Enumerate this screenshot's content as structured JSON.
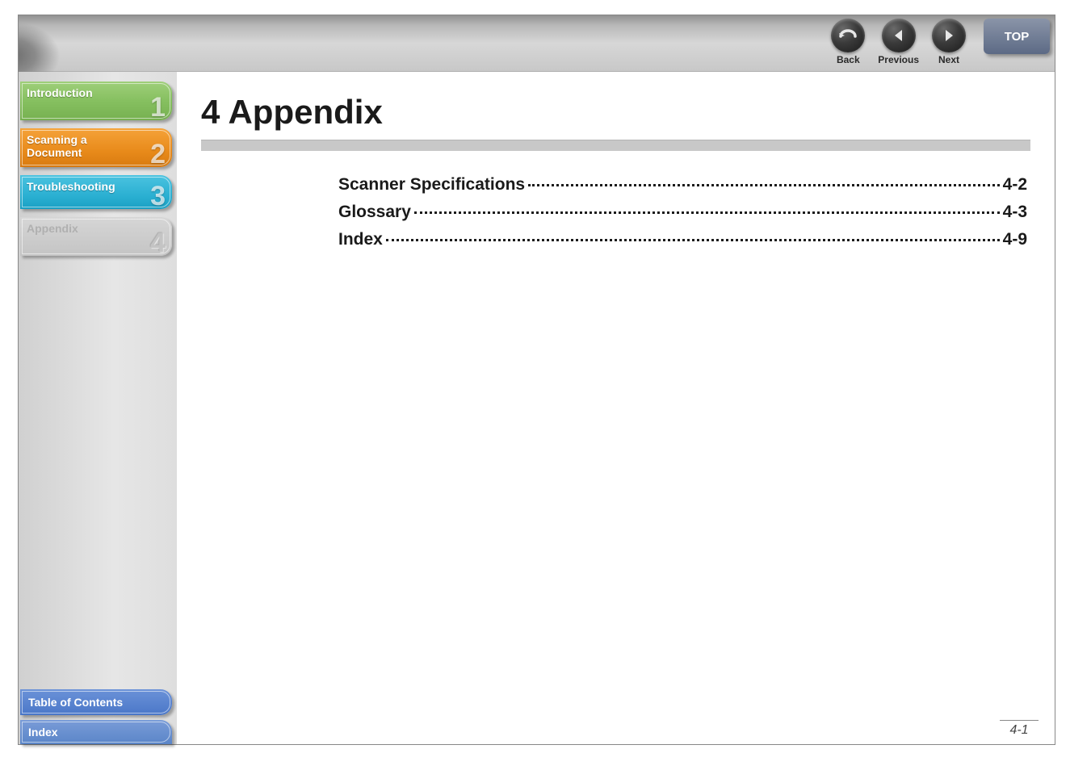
{
  "nav": {
    "back": "Back",
    "previous": "Previous",
    "next": "Next",
    "top": "TOP"
  },
  "sidebar": {
    "tabs": [
      {
        "label": "Introduction",
        "num": "1"
      },
      {
        "label": "Scanning a\nDocument",
        "num": "2"
      },
      {
        "label": "Troubleshooting",
        "num": "3"
      },
      {
        "label": "Appendix",
        "num": "4"
      }
    ],
    "bottom": [
      {
        "label": "Table of Contents"
      },
      {
        "label": "Index"
      }
    ]
  },
  "content": {
    "title": "4 Appendix",
    "toc": [
      {
        "title": "Scanner Specifications",
        "page": "4-2"
      },
      {
        "title": "Glossary",
        "page": "4-3"
      },
      {
        "title": "Index",
        "page": "4-9"
      }
    ],
    "page_number": "4-1"
  }
}
